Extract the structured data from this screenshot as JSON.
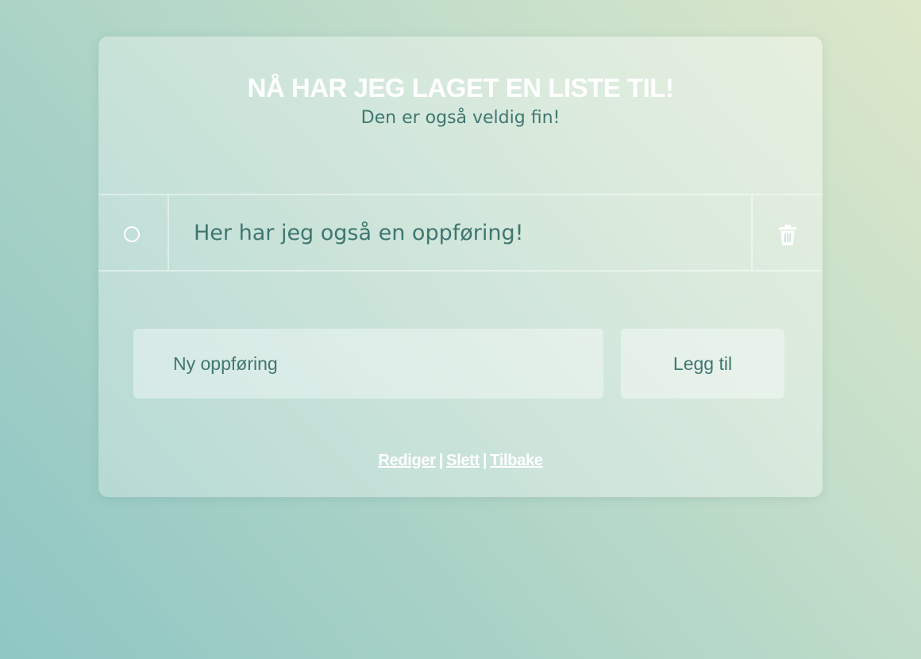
{
  "list": {
    "title": "NÅ HAR JEG LAGET EN LISTE TIL!",
    "subtitle": "Den er også veldig fin!"
  },
  "items": [
    {
      "text": "Her har jeg også en oppføring!",
      "checked": false
    }
  ],
  "new_item": {
    "placeholder": "Ny oppføring",
    "value": "",
    "add_label": "Legg til"
  },
  "footer": {
    "edit_label": "Rediger",
    "delete_label": "Slett",
    "back_label": "Tilbake",
    "separator": "|"
  },
  "icons": {
    "check": "circle-outline-icon",
    "delete": "trash-icon"
  },
  "colors": {
    "text": "#3f7670",
    "heading": "#ffffff"
  }
}
